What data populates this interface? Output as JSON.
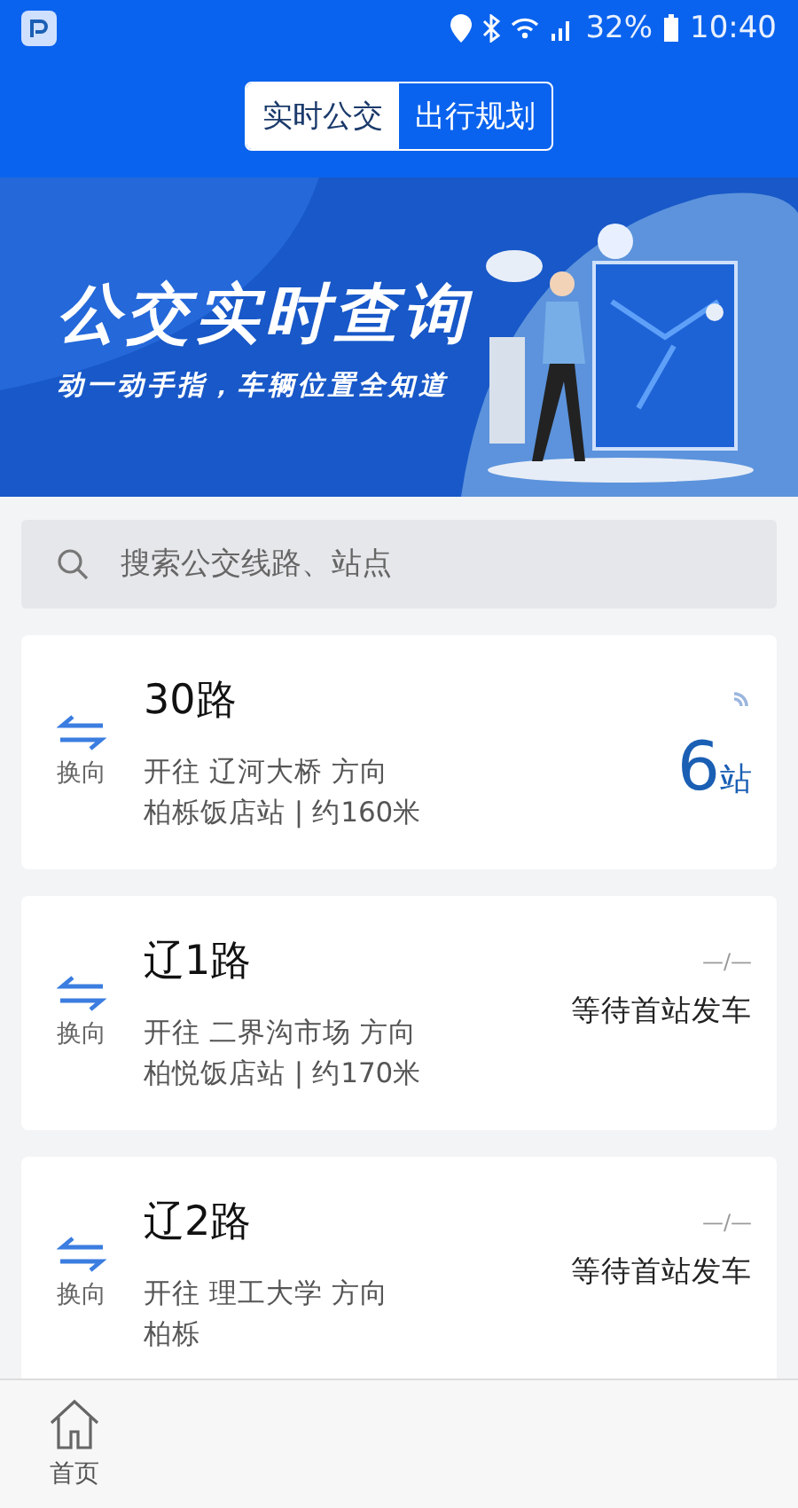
{
  "status_bar": {
    "battery": "32%",
    "time": "10:40"
  },
  "tabs": [
    {
      "label": "实时公交",
      "selected": true
    },
    {
      "label": "出行规划",
      "selected": false
    }
  ],
  "banner": {
    "title": "公交实时查询",
    "subtitle": "动一动手指，车辆位置全知道",
    "kind": "picture"
  },
  "search": {
    "placeholder": "搜索公交线路、站点"
  },
  "routes": [
    {
      "kind": "stops",
      "swap_label": "换向",
      "name": "30路",
      "direction": "开往 辽河大桥 方向",
      "station": "柏栎饭店站 | 约160米",
      "count": "6",
      "unit": "站"
    },
    {
      "kind": "waiting",
      "swap_label": "换向",
      "name": "辽1路",
      "direction": "开往 二界沟市场 方向",
      "station": "柏悦饭店站 | 约170米",
      "dash": "—/—",
      "status": "等待首站发车"
    },
    {
      "kind": "waiting",
      "swap_label": "换向",
      "name": "辽2路",
      "direction": "开往 理工大学 方向",
      "station": "柏栎",
      "dash": "—/—",
      "status": "等待首站发车"
    }
  ],
  "nav": [
    {
      "label": "首页"
    }
  ]
}
